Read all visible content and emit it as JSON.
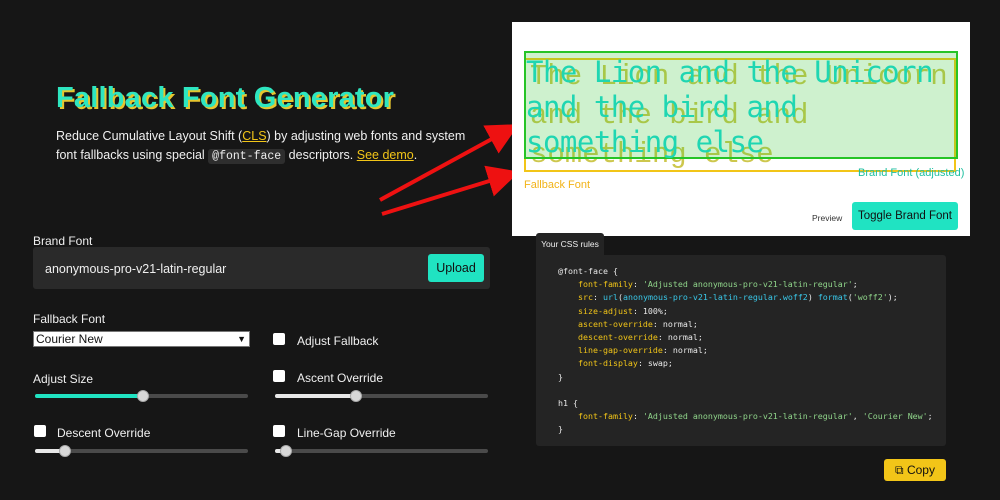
{
  "header": {
    "title": "Fallback Font Generator",
    "intro_part1": "Reduce Cumulative Layout Shift (",
    "intro_cls": "CLS",
    "intro_part2": ") by adjusting web fonts and system font fallbacks using special ",
    "intro_code": "@font-face",
    "intro_part3": " descriptors. ",
    "intro_demo": "See demo",
    "intro_end": "."
  },
  "form": {
    "brand_font_label": "Brand Font",
    "brand_font_value": "anonymous-pro-v21-latin-regular",
    "upload_label": "Upload",
    "fallback_font_label": "Fallback Font",
    "fallback_font_selected": "Courier New",
    "adjust_fallback_label": "Adjust Fallback",
    "adjust_size_label": "Adjust Size",
    "adjust_size_value": 0.5,
    "ascent_override_label": "Ascent Override",
    "ascent_override_value": 0.38,
    "descent_override_label": "Descent Override",
    "descent_override_value": 0.12,
    "line_gap_override_label": "Line-Gap Override",
    "line_gap_override_value": 0.05
  },
  "preview": {
    "sample_text": "The Lion and the Unicorn and the bird and something else",
    "fallback_label": "Fallback Font",
    "brand_label": "Brand Font (adjusted)",
    "preview_label": "Preview",
    "toggle_label": "Toggle Brand Font"
  },
  "css_panel": {
    "tab_label": "Your CSS rules",
    "copy_label": "Copy"
  },
  "colors": {
    "accent": "#20e3c2",
    "highlight": "#f2c518",
    "background": "#161616"
  }
}
